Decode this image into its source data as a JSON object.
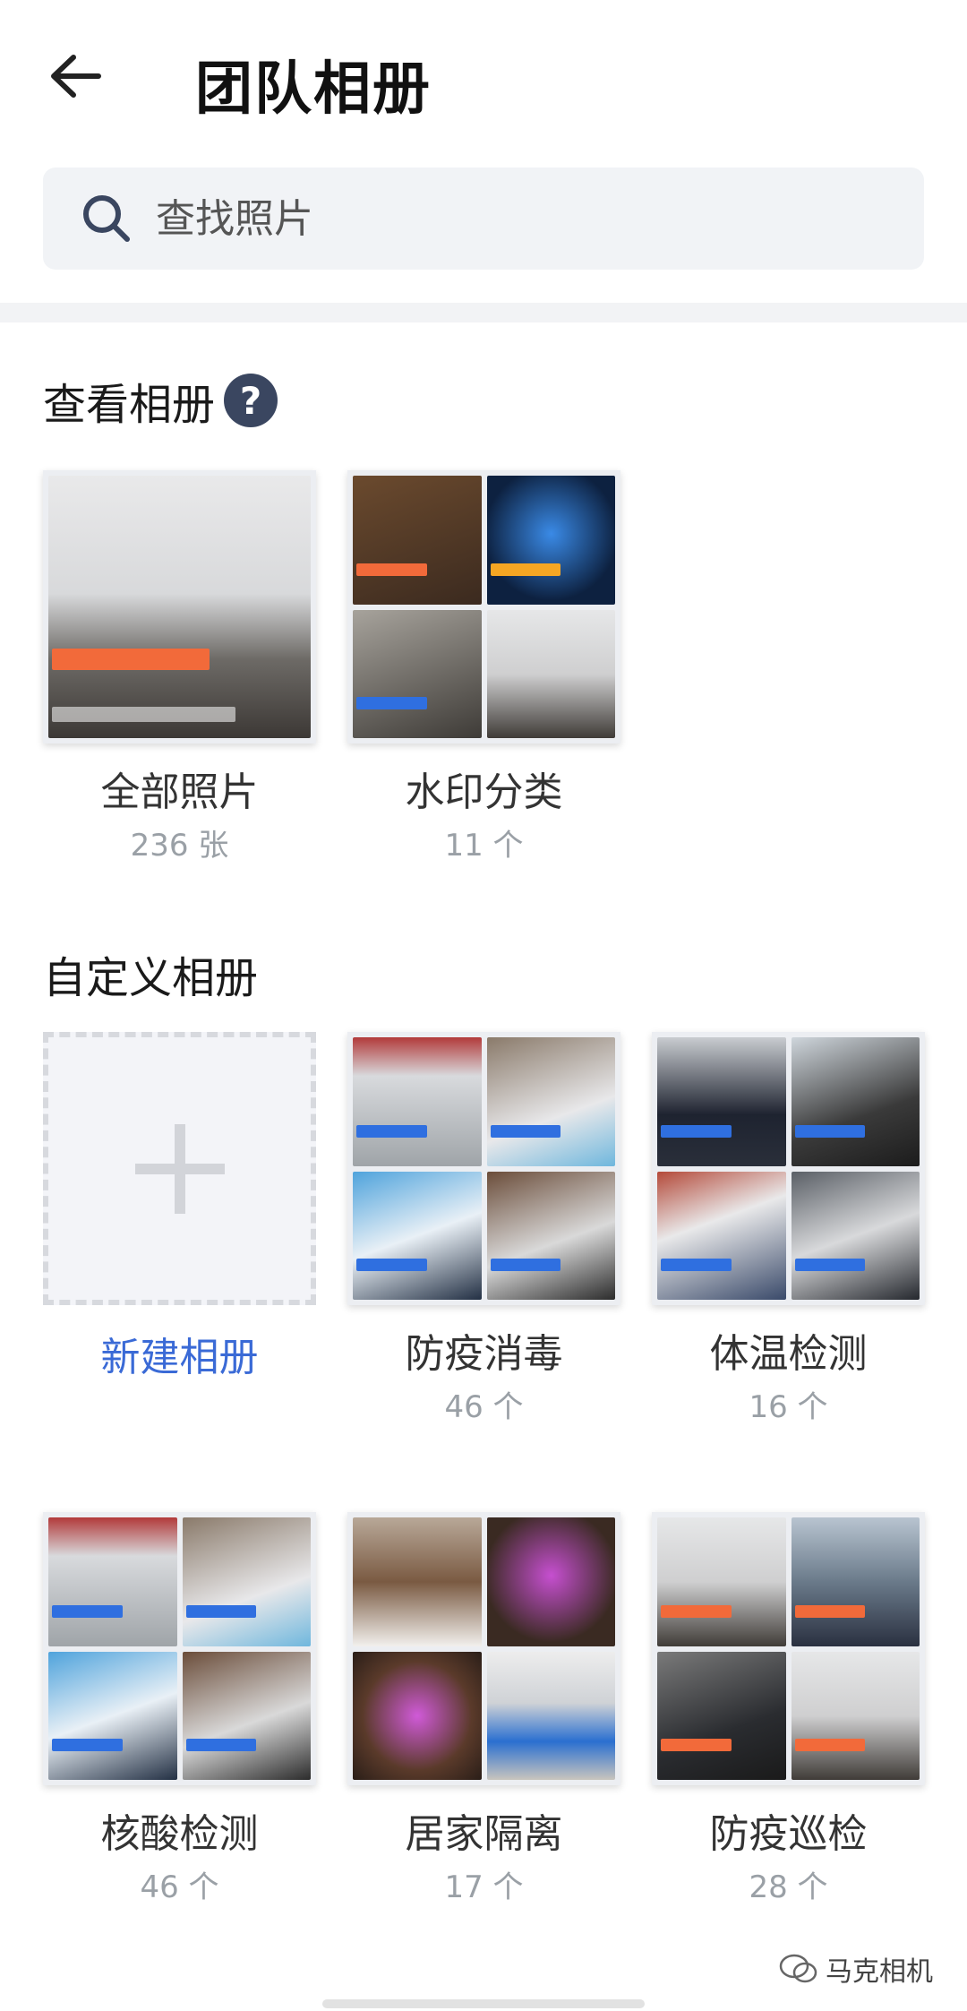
{
  "header": {
    "title": "团队相册"
  },
  "search": {
    "placeholder": "查找照片"
  },
  "sections": {
    "view_albums": "查看相册",
    "custom_albums": "自定义相册",
    "help_glyph": "?"
  },
  "view_albums": [
    {
      "name": "全部照片",
      "count": "236 张"
    },
    {
      "name": "水印分类",
      "count": "11 个"
    }
  ],
  "new_album": {
    "label": "新建相册"
  },
  "custom_albums": [
    {
      "name": "防疫消毒",
      "count": "46 个"
    },
    {
      "name": "体温检测",
      "count": "16 个"
    },
    {
      "name": "核酸检测",
      "count": "46 个"
    },
    {
      "name": "居家隔离",
      "count": "17 个"
    },
    {
      "name": "防疫巡检",
      "count": "28 个"
    }
  ],
  "watermark": {
    "brand": "马克相机"
  },
  "colors": {
    "accent": "#3a6ad6",
    "help_bg": "#3a4660",
    "watermark_orange": "#f26a3a",
    "watermark_blue": "#2f6fe0"
  }
}
